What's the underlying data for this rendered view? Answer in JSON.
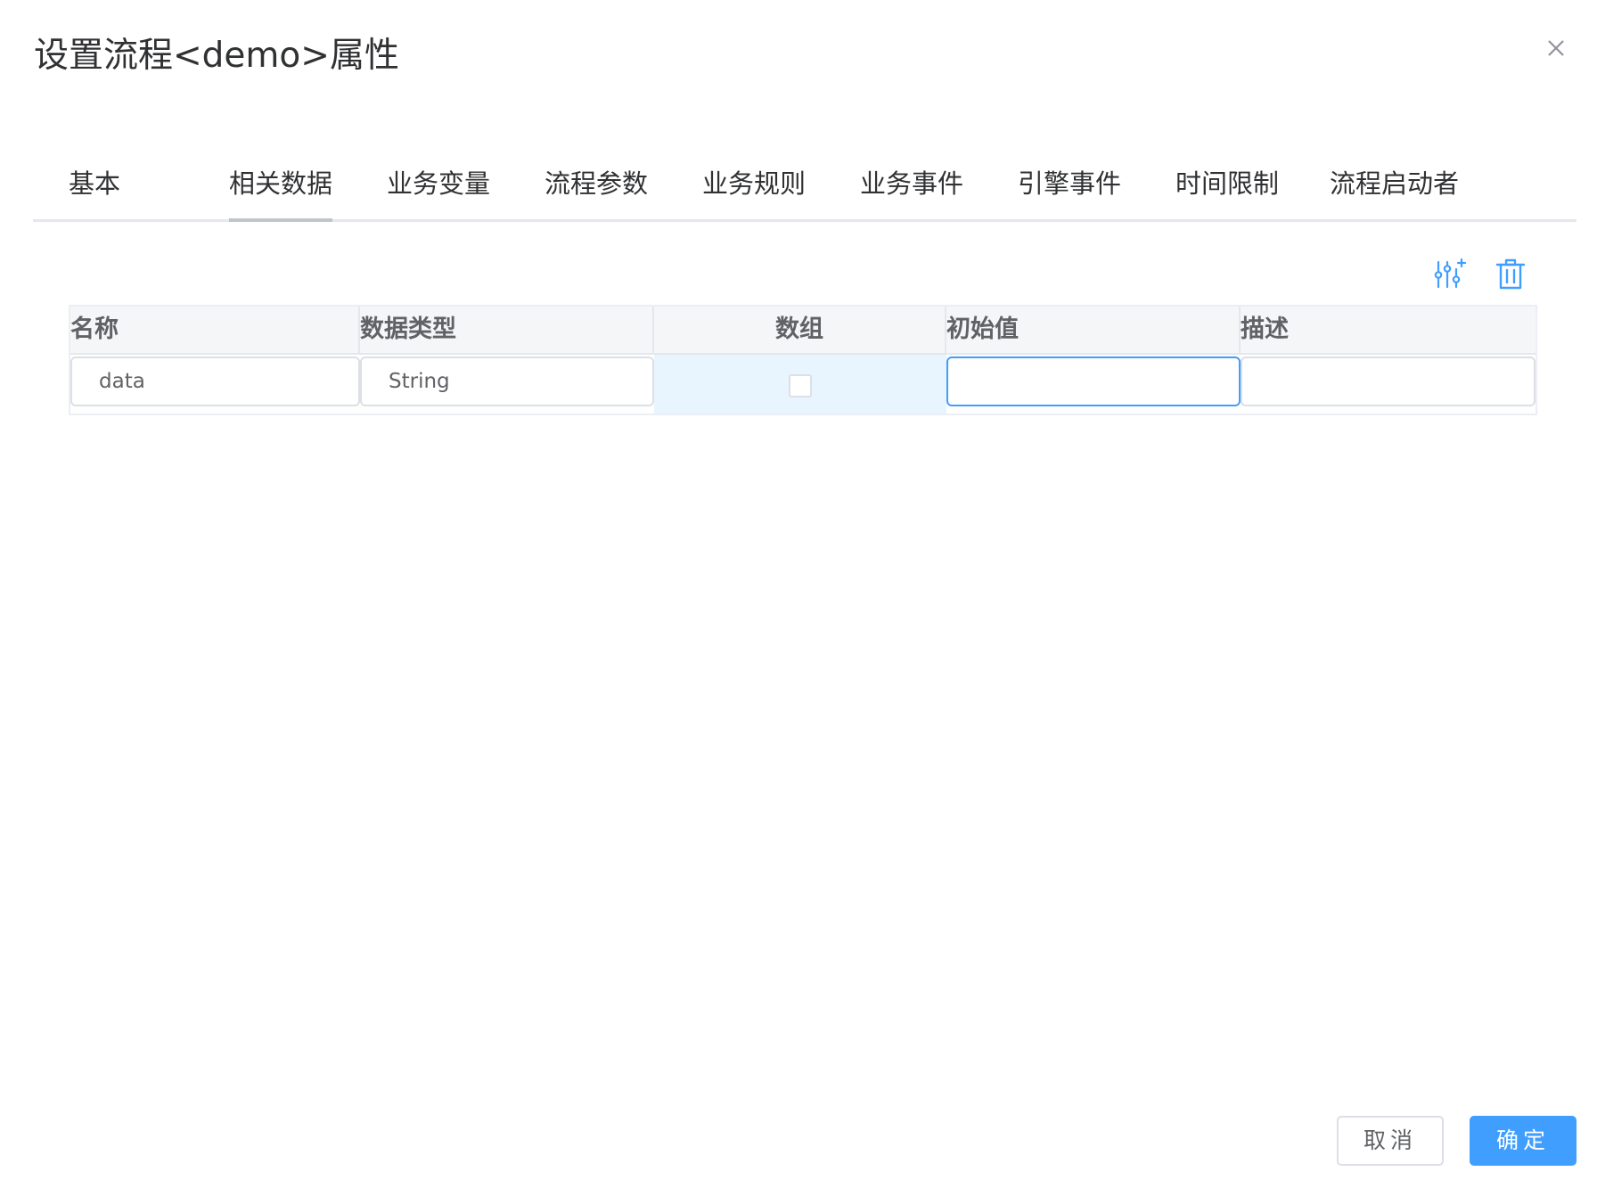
{
  "dialog": {
    "title": "设置流程<demo>属性",
    "close_icon": "close-icon"
  },
  "tabs": [
    {
      "label": "基本",
      "active": false
    },
    {
      "label": "相关数据",
      "active": true
    },
    {
      "label": "业务变量",
      "active": false
    },
    {
      "label": "流程参数",
      "active": false
    },
    {
      "label": "业务规则",
      "active": false
    },
    {
      "label": "业务事件",
      "active": false
    },
    {
      "label": "引擎事件",
      "active": false
    },
    {
      "label": "时间限制",
      "active": false
    },
    {
      "label": "流程启动者",
      "active": false
    }
  ],
  "toolbar": {
    "add_icon": "sliders-add-icon",
    "delete_icon": "trash-icon"
  },
  "table": {
    "columns": [
      "名称",
      "数据类型",
      "数组",
      "初始值",
      "描述"
    ],
    "rows": [
      {
        "name": "data",
        "data_type": "String",
        "is_array": false,
        "initial_value": "",
        "description": ""
      }
    ]
  },
  "footer": {
    "cancel_label": "取消",
    "confirm_label": "确定"
  },
  "colors": {
    "primary": "#409eff",
    "selected_row": "#e8f4fe",
    "header_bg": "#f5f6f7"
  }
}
